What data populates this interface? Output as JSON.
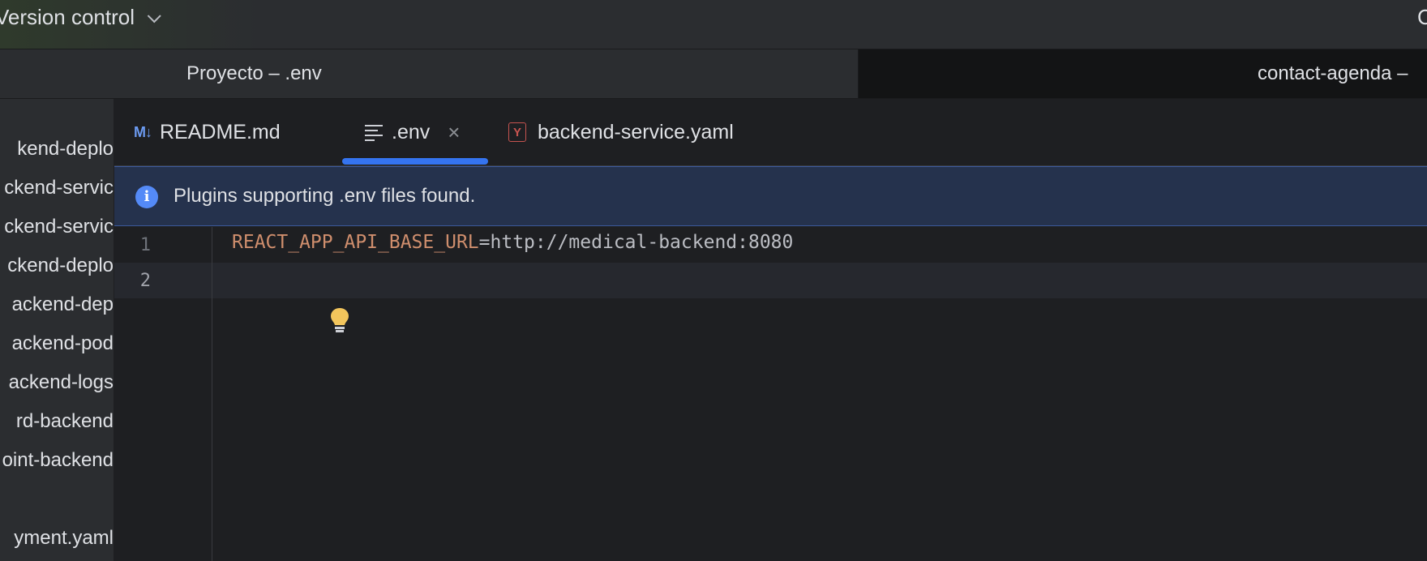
{
  "topbar": {
    "vcs_label": "Version control",
    "right_fragment": "C"
  },
  "window_tabs": [
    {
      "label": "Proyecto – .env"
    },
    {
      "label": "contact-agenda –"
    }
  ],
  "project_tree": {
    "items": [
      "kend-deplo",
      "ckend-servic",
      "ckend-servic",
      "ckend-deplo",
      "ackend-dep",
      "ackend-pod",
      "ackend-logs",
      "rd-backend",
      "oint-backend",
      "yment.yaml"
    ]
  },
  "editor_tabs": [
    {
      "label": "README.md",
      "icon": "markdown-icon",
      "icon_text": "M↓"
    },
    {
      "label": ".env",
      "icon": "text-file-icon",
      "active": true,
      "close": "×"
    },
    {
      "label": "backend-service.yaml",
      "icon": "yaml-icon",
      "icon_text": "Y"
    }
  ],
  "banner": {
    "message": "Plugins supporting .env files found.",
    "icon": "info-icon",
    "icon_text": "i"
  },
  "code": {
    "line_numbers": [
      "1",
      "2"
    ],
    "lines": [
      {
        "key": "REACT_APP_API_BASE_URL",
        "eq": "=",
        "value": "http://medical-backend:8080"
      },
      {
        "key": "",
        "eq": "",
        "value": ""
      }
    ]
  },
  "colors": {
    "accent": "#3574f0",
    "banner_bg": "#25324d",
    "env_key": "#cf8e6d",
    "bulb": "#f2c55c"
  }
}
